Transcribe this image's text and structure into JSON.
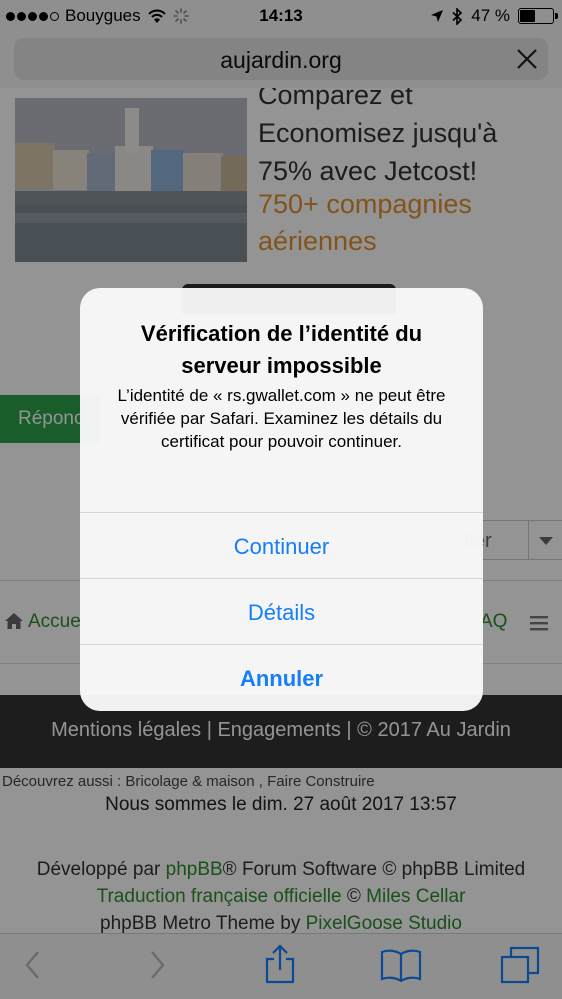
{
  "status_bar": {
    "carrier": "Bouygues",
    "time": "14:13",
    "battery_percent": "47 %",
    "battery_level": 0.47,
    "icons": [
      "signal-dots-icon",
      "wifi-icon",
      "activity-spinner-icon",
      "location-arrow-icon",
      "bluetooth-icon",
      "battery-icon"
    ]
  },
  "address_bar": {
    "url": "aujardin.org"
  },
  "page": {
    "ad_text": "Comparez et Economisez jusqu'à 75% avec Jetcost!",
    "ad_highlight": "750+ compagnies aériennes",
    "reply_button": "Réponc",
    "select_value": "ller",
    "nav": {
      "home": "Accue",
      "faq": "AQ"
    },
    "footer_links": "Mentions légales | Engagements | © 2017 Au Jardin",
    "discover": "Découvrez aussi : Bricolage & maison , Faire Construire",
    "datetime": "Nous sommes le dim. 27 août 2017 13:57",
    "credits": {
      "line1_prefix": "Développé par ",
      "line1_link": "phpBB",
      "line1_suffix": "® Forum Software © phpBB Limited",
      "line2_link": "Traduction française officielle",
      "line2_mid": " © ",
      "line2_link2": "Miles Cellar",
      "line3_prefix": "phpBB Metro Theme by ",
      "line3_link": "PixelGoose Studio"
    }
  },
  "alert": {
    "title": "Vérification de l’identité du serveur impossible",
    "message": "L’identité de « rs.gwallet.com » ne peut être vérifiée par Safari. Examinez les détails du certificat pour pouvoir continuer.",
    "buttons": [
      "Continuer",
      "Détails",
      "Annuler"
    ]
  },
  "colors": {
    "accent": "#147efb",
    "link_green": "#2e8b2e",
    "ad_orange": "#e2902f"
  }
}
